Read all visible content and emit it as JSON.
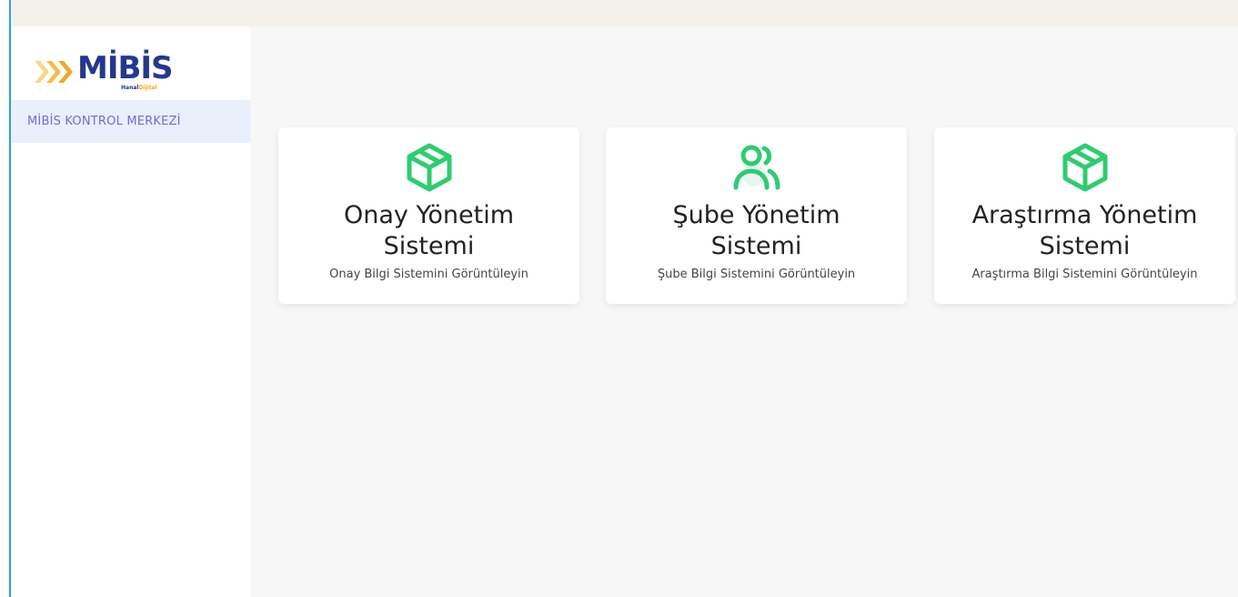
{
  "logo": {
    "text": "MİBİS",
    "sub_prefix": "Hanal",
    "sub_accent": "Dijital",
    "chevron_color": "#f5a623",
    "text_color": "#24378f"
  },
  "sidebar": {
    "items": [
      {
        "label": "MİBİS KONTROL MERKEZİ"
      }
    ]
  },
  "cards": [
    {
      "icon": "package-icon",
      "title_line1": "Onay Yönetim",
      "title_line2": "Sistemi",
      "subtitle": "Onay Bilgi Sistemini Görüntüleyin"
    },
    {
      "icon": "users-icon",
      "title_line1": "Şube Yönetim",
      "title_line2": "Sistemi",
      "subtitle": "Şube Bilgi Sistemini Görüntüleyin"
    },
    {
      "icon": "package-icon",
      "title_line1": "Araştırma Yönetim",
      "title_line2": "Sistemi",
      "subtitle": "Araştırma Bilgi Sistemini Görüntüleyin"
    }
  ],
  "colors": {
    "icon_green": "#2ecc71",
    "nav_active_bg": "#e9f0fb",
    "nav_active_text": "#6f6bd6",
    "topbar_bg": "#f3f1ea"
  }
}
